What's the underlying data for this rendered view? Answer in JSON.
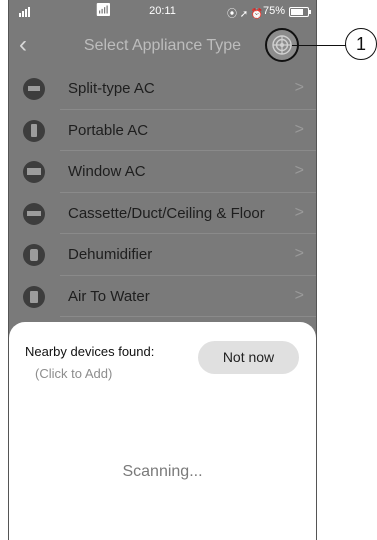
{
  "status_bar": {
    "time": "20:11",
    "battery": "75%",
    "icons": "⦿ ➚ ⏰"
  },
  "nav": {
    "back_icon": "chevron-left-icon",
    "title": "Select Appliance Type",
    "radar_icon": "radar-icon"
  },
  "appliances": [
    {
      "label": "Split-type AC",
      "icon": "split-ac-icon"
    },
    {
      "label": "Portable AC",
      "icon": "portable-ac-icon"
    },
    {
      "label": "Window AC",
      "icon": "window-ac-icon"
    },
    {
      "label": "Cassette/Duct/Ceiling & Floor",
      "icon": "cassette-ac-icon"
    },
    {
      "label": "Dehumidifier",
      "icon": "dehumidifier-icon"
    },
    {
      "label": "Air To Water",
      "icon": "air-to-water-icon"
    }
  ],
  "chevron": ">",
  "sheet": {
    "found_label": "Nearby devices found:",
    "hint": "(Click to Add)",
    "not_now_label": "Not now",
    "scanning": "Scanning..."
  },
  "callout": {
    "number": "1"
  }
}
